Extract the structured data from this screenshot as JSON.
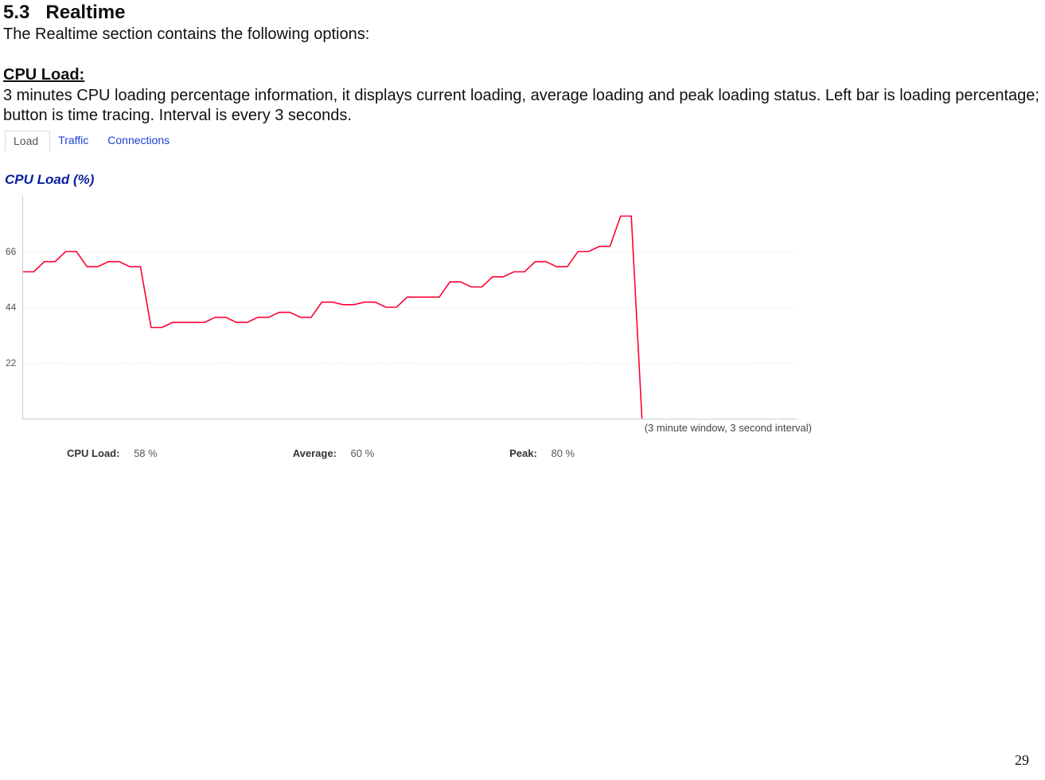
{
  "section": {
    "number": "5.3",
    "title": "Realtime",
    "intro": "The Realtime section contains the following options:",
    "sub_heading": "CPU Load:",
    "body": "3 minutes CPU loading percentage information, it displays current loading, average loading and peak loading status. Left bar is loading percentage; button is time tracing. Interval is every 3 seconds."
  },
  "tabs": {
    "load": "Load",
    "traffic": "Traffic",
    "connections": "Connections"
  },
  "chart_title": "CPU Load (%)",
  "caption": "(3 minute window, 3 second interval)",
  "stats": {
    "cpu_label": "CPU Load:",
    "cpu_value": "58 %",
    "avg_label": "Average:",
    "avg_value": "60 %",
    "peak_label": "Peak:",
    "peak_value": "80 %"
  },
  "page_number": "29",
  "chart_data": {
    "type": "line",
    "title": "CPU Load (%)",
    "xlabel": "",
    "ylabel": "",
    "ylim": [
      0,
      88
    ],
    "yticks": [
      22,
      44,
      66
    ],
    "series": [
      {
        "name": "CPU Load",
        "color": "#ff0033",
        "values": [
          58,
          58,
          62,
          62,
          66,
          66,
          60,
          60,
          62,
          62,
          60,
          60,
          36,
          36,
          38,
          38,
          38,
          38,
          40,
          40,
          38,
          38,
          40,
          40,
          42,
          42,
          40,
          40,
          46,
          46,
          45,
          45,
          46,
          46,
          44,
          44,
          48,
          48,
          48,
          48,
          54,
          54,
          52,
          52,
          56,
          56,
          58,
          58,
          62,
          62,
          60,
          60,
          66,
          66,
          68,
          68,
          80,
          80,
          0
        ]
      }
    ]
  }
}
